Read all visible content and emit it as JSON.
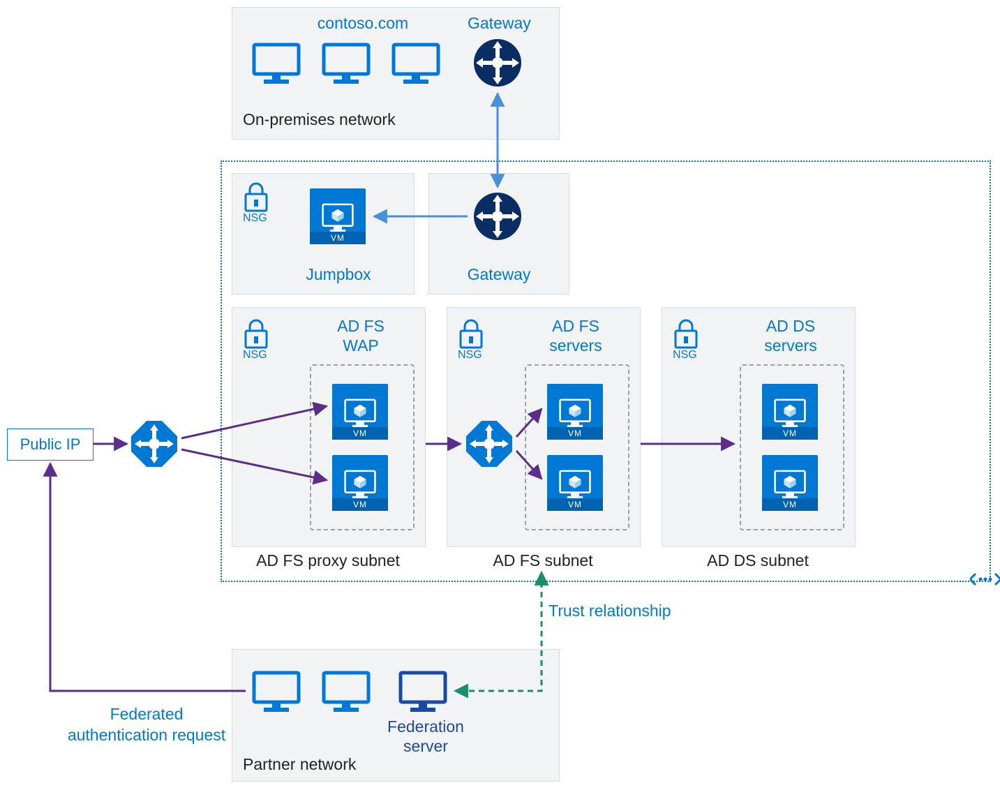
{
  "onprem": {
    "title": "On-premises network",
    "domain": "contoso.com",
    "gateway": "Gateway"
  },
  "azure": {
    "jumpbox": {
      "nsg": "NSG",
      "label": "Jumpbox"
    },
    "gateway": "Gateway",
    "wap": {
      "nsg": "NSG",
      "title": "AD FS\nWAP",
      "subnet": "AD FS proxy subnet"
    },
    "adfs": {
      "nsg": "NSG",
      "title": "AD FS\nservers",
      "subnet": "AD FS subnet"
    },
    "adds": {
      "nsg": "NSG",
      "title": "AD DS\nservers",
      "subnet": "AD DS subnet"
    }
  },
  "public_ip": "Public IP",
  "trust": "Trust relationship",
  "fed_label1": "Federated",
  "fed_label2": "authentication request",
  "partner": {
    "title": "Partner network",
    "server": "Federation\nserver"
  },
  "vm_label": "VM"
}
